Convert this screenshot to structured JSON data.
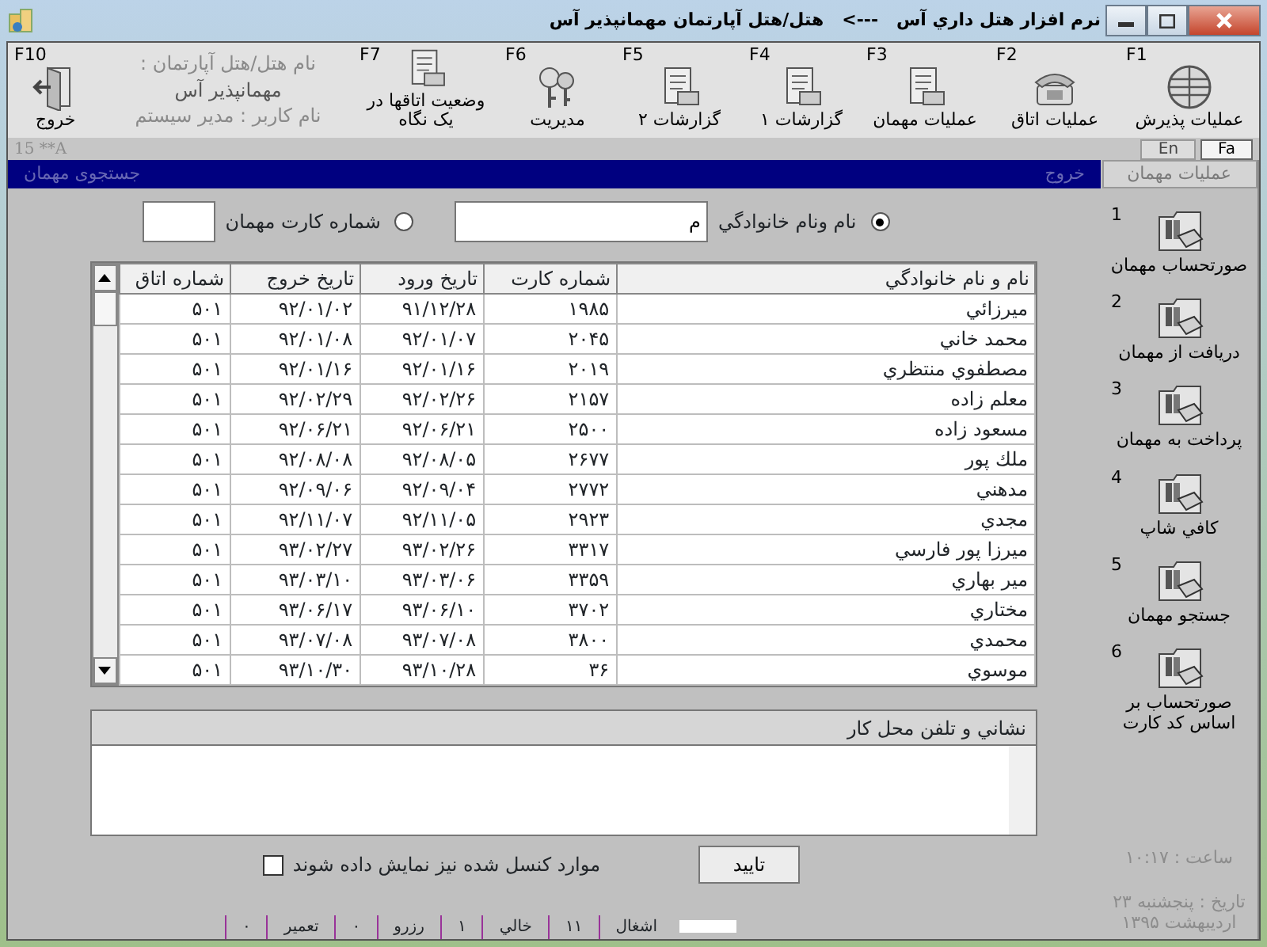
{
  "window": {
    "title": "نرم افزار هتل داري آس   --->   هتل/هتل آپارتمان مهمانپذير آس"
  },
  "toolbar": [
    {
      "key": "F1",
      "label": "عمليات پذيرش"
    },
    {
      "key": "F2",
      "label": "عمليات اتاق"
    },
    {
      "key": "F3",
      "label": "عمليات مهمان"
    },
    {
      "key": "F4",
      "label": "گزارشات ۱"
    },
    {
      "key": "F5",
      "label": "گزارشات ۲"
    },
    {
      "key": "F6",
      "label": "مديريت"
    },
    {
      "key": "F7",
      "label": "وضعيت اتاقها در يک نگاه"
    },
    {
      "key": "F10",
      "label": "خروج"
    }
  ],
  "hotel_info": {
    "label": "نام هتل/هتل آپارتمان :",
    "name": "مهمانپذير آس",
    "user": "نام کاربر : مدير سيستم"
  },
  "info_strip": {
    "code": "15 **A",
    "languages": [
      {
        "label": "Fa",
        "selected": true
      },
      {
        "label": "En",
        "selected": false
      }
    ]
  },
  "form_bar": {
    "title": "جستجوی مهمان",
    "exit": "خروج"
  },
  "side_panel": {
    "tab": "عمليات مهمان",
    "items": [
      {
        "number": "1",
        "label": "صورتحساب مهمان"
      },
      {
        "number": "2",
        "label": "دريافت از مهمان"
      },
      {
        "number": "3",
        "label": "پرداخت به مهمان"
      },
      {
        "number": "4",
        "label": "کافي شاپ"
      },
      {
        "number": "5",
        "label": "جستجو مهمان"
      },
      {
        "number": "6",
        "label": "صورتحساب بر اساس کد کارت"
      }
    ],
    "clock": "ساعت : ۱۰:۱۷",
    "date": "تاريخ : پنجشنبه ۲۳ ارديبهشت ۱۳۹۵"
  },
  "search": {
    "options": [
      {
        "label": "نام ونام خانوادگي",
        "selected": true,
        "value": "م"
      },
      {
        "label": "شماره کارت مهمان",
        "selected": false
      }
    ]
  },
  "table": {
    "columns": [
      "نام و نام خانوادگي",
      "شماره کارت",
      "تاريخ ورود",
      "تاريخ خروج",
      "شماره اتاق"
    ],
    "rows": [
      [
        "ميرزائي",
        "۱۹۸۵",
        "۹۱/۱۲/۲۸",
        "۹۲/۰۱/۰۲",
        "۵۰۱"
      ],
      [
        "محمد خاني",
        "۲۰۴۵",
        "۹۲/۰۱/۰۷",
        "۹۲/۰۱/۰۸",
        "۵۰۱"
      ],
      [
        "مصطفوي منتظري",
        "۲۰۱۹",
        "۹۲/۰۱/۱۶",
        "۹۲/۰۱/۱۶",
        "۵۰۱"
      ],
      [
        "معلم زاده",
        "۲۱۵۷",
        "۹۲/۰۲/۲۶",
        "۹۲/۰۲/۲۹",
        "۵۰۱"
      ],
      [
        "مسعود زاده",
        "۲۵۰۰",
        "۹۲/۰۶/۲۱",
        "۹۲/۰۶/۲۱",
        "۵۰۱"
      ],
      [
        "ملك پور",
        "۲۶۷۷",
        "۹۲/۰۸/۰۵",
        "۹۲/۰۸/۰۸",
        "۵۰۱"
      ],
      [
        "مدهني",
        "۲۷۷۲",
        "۹۲/۰۹/۰۴",
        "۹۲/۰۹/۰۶",
        "۵۰۱"
      ],
      [
        "مجدي",
        "۲۹۲۳",
        "۹۲/۱۱/۰۵",
        "۹۲/۱۱/۰۷",
        "۵۰۱"
      ],
      [
        "ميرزا پور فارسي",
        "۳۳۱۷",
        "۹۳/۰۲/۲۶",
        "۹۳/۰۲/۲۷",
        "۵۰۱"
      ],
      [
        "مير بهاري",
        "۳۳۵۹",
        "۹۳/۰۳/۰۶",
        "۹۳/۰۳/۱۰",
        "۵۰۱"
      ],
      [
        "مختاري",
        "۳۷۰۲",
        "۹۳/۰۶/۱۰",
        "۹۳/۰۶/۱۷",
        "۵۰۱"
      ],
      [
        "محمدي",
        "۳۸۰۰",
        "۹۳/۰۷/۰۸",
        "۹۳/۰۷/۰۸",
        "۵۰۱"
      ],
      [
        "موسوي",
        "۳۶",
        "۹۳/۱۰/۲۸",
        "۹۳/۱۰/۳۰",
        "۵۰۱"
      ]
    ]
  },
  "address": {
    "title": "نشاني و تلفن محل کار"
  },
  "show_cancelled": {
    "label": "موارد کنسل شده نيز نمايش داده شوند",
    "checked": false
  },
  "ok_button": "تاييد",
  "legend": [
    {
      "label": "اشغال",
      "count": "۱۱"
    },
    {
      "label": "خالي",
      "count": "۱"
    },
    {
      "label": "رزرو",
      "count": "۰"
    },
    {
      "label": "تعمير",
      "count": "۰"
    }
  ]
}
